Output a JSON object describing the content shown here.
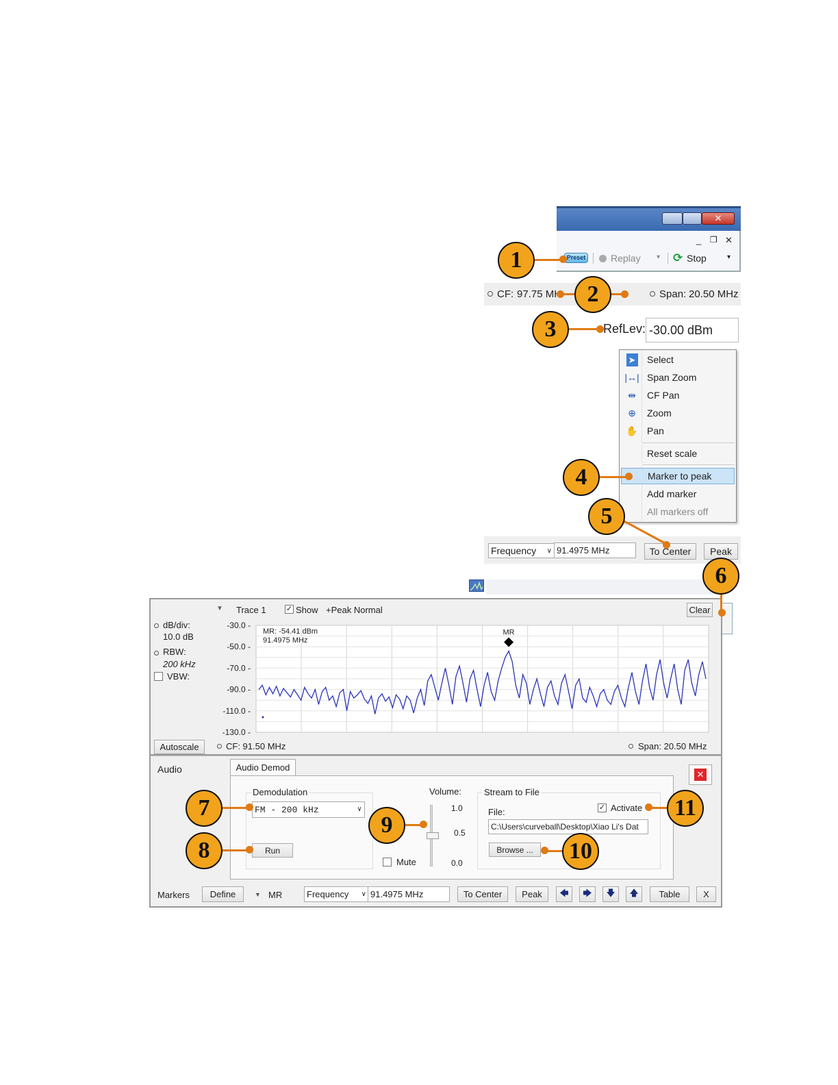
{
  "callouts": [
    "1",
    "2",
    "3",
    "4",
    "5",
    "6",
    "7",
    "8",
    "9",
    "10",
    "11"
  ],
  "toolbar": {
    "min_glyph": "_",
    "restore_glyph": "❐",
    "close_glyph": "✕",
    "preset_label": "Preset",
    "replay_label": "Replay",
    "stop_label": "Stop"
  },
  "cf_bar": {
    "cf_label": "CF:",
    "cf_value": "97.75 MH",
    "span_label": "Span:",
    "span_value": "20.50 MHz"
  },
  "reflev": {
    "label": "RefLev:",
    "value": "-30.00 dBm"
  },
  "context_menu": {
    "items": [
      {
        "label": "Select",
        "icon": "cursor-arrow-icon"
      },
      {
        "label": "Span Zoom",
        "icon": "span-zoom-icon"
      },
      {
        "label": "CF Pan",
        "icon": "cf-pan-icon"
      },
      {
        "label": "Zoom",
        "icon": "zoom-icon"
      },
      {
        "label": "Pan",
        "icon": "hand-pan-icon"
      },
      {
        "label": "Reset scale",
        "icon": ""
      },
      {
        "label": "Marker to peak",
        "icon": ""
      },
      {
        "label": "Add marker",
        "icon": ""
      },
      {
        "label": "All markers off",
        "icon": ""
      }
    ],
    "highlighted": "Marker to peak",
    "highlight_color": "#cce4f7"
  },
  "marker_bar_top": {
    "type_value": "Frequency",
    "freq_value": "91.4975 MHz",
    "to_center_label": "To Center",
    "peak_label": "Peak"
  },
  "spectrum": {
    "trace_label": "Trace 1",
    "show_label": "Show",
    "show_checked": true,
    "detector_label": "+Peak Normal",
    "clear_label": "Clear",
    "dbdiv_label": "dB/div:",
    "dbdiv_value": "10.0 dB",
    "rbw_label": "RBW:",
    "rbw_value": "200 kHz",
    "vbw_label": "VBW:",
    "marker_readout_level": "MR: -54.41 dBm",
    "marker_readout_freq": "91.4975 MHz",
    "marker_name": "MR",
    "autoscale_label": "Autoscale",
    "cf_text": "CF: 91.50 MHz",
    "span_text": "Span: 20.50 MHz"
  },
  "chart_data": {
    "type": "line",
    "title": "",
    "xlabel": "",
    "ylabel": "",
    "ylim": [
      -130,
      -30
    ],
    "yticks": [
      "-30.0",
      "-50.0",
      "-70.0",
      "-90.0",
      "-110.0",
      "-130.0"
    ],
    "series": [
      {
        "color": "#2b34b8",
        "values": [
          -90,
          -86,
          -95,
          -88,
          -94,
          -87,
          -96,
          -89,
          -93,
          -97,
          -90,
          -95,
          -100,
          -88,
          -94,
          -98,
          -90,
          -104,
          -92,
          -88,
          -100,
          -96,
          -106,
          -93,
          -90,
          -110,
          -92,
          -98,
          -95,
          -91,
          -99,
          -103,
          -96,
          -113,
          -98,
          -94,
          -101,
          -97,
          -107,
          -95,
          -99,
          -108,
          -96,
          -100,
          -112,
          -98,
          -90,
          -105,
          -82,
          -76,
          -88,
          -100,
          -84,
          -70,
          -86,
          -104,
          -78,
          -68,
          -84,
          -102,
          -80,
          -72,
          -90,
          -106,
          -86,
          -74,
          -92,
          -100,
          -82,
          -70,
          -60,
          -54,
          -64,
          -86,
          -98,
          -76,
          -84,
          -104,
          -90,
          -80,
          -94,
          -106,
          -88,
          -82,
          -96,
          -104,
          -84,
          -76,
          -92,
          -108,
          -86,
          -80,
          -98,
          -102,
          -88,
          -96,
          -106,
          -94,
          -90,
          -100,
          -104,
          -92,
          -86,
          -98,
          -106,
          -88,
          -74,
          -92,
          -104,
          -82,
          -66,
          -88,
          -100,
          -76,
          -62,
          -84,
          -98,
          -80,
          -66,
          -90,
          -104,
          -72,
          -62,
          -84,
          -96,
          -76,
          -64,
          -80
        ]
      }
    ]
  },
  "audio": {
    "panel_label": "Audio",
    "tab_label": "Audio Demod",
    "demod_group": "Demodulation",
    "demod_value": "FM - 200 kHz",
    "run_label": "Run",
    "volume_label": "Volume:",
    "vol_ticks": [
      "1.0",
      "0.5",
      "0.0"
    ],
    "mute_label": "Mute",
    "stream_group": "Stream to File",
    "file_label": "File:",
    "activate_label": "Activate",
    "activate_checked": true,
    "file_path": "C:\\Users\\curveball\\Desktop\\Xiao Li's Dat",
    "browse_label": "Browse ..."
  },
  "markers_bar": {
    "label": "Markers",
    "define_label": "Define",
    "marker_name": "MR",
    "type_value": "Frequency",
    "freq_value": "91.4975 MHz",
    "to_center_label": "To Center",
    "peak_label": "Peak",
    "table_label": "Table",
    "close_label": "X"
  }
}
